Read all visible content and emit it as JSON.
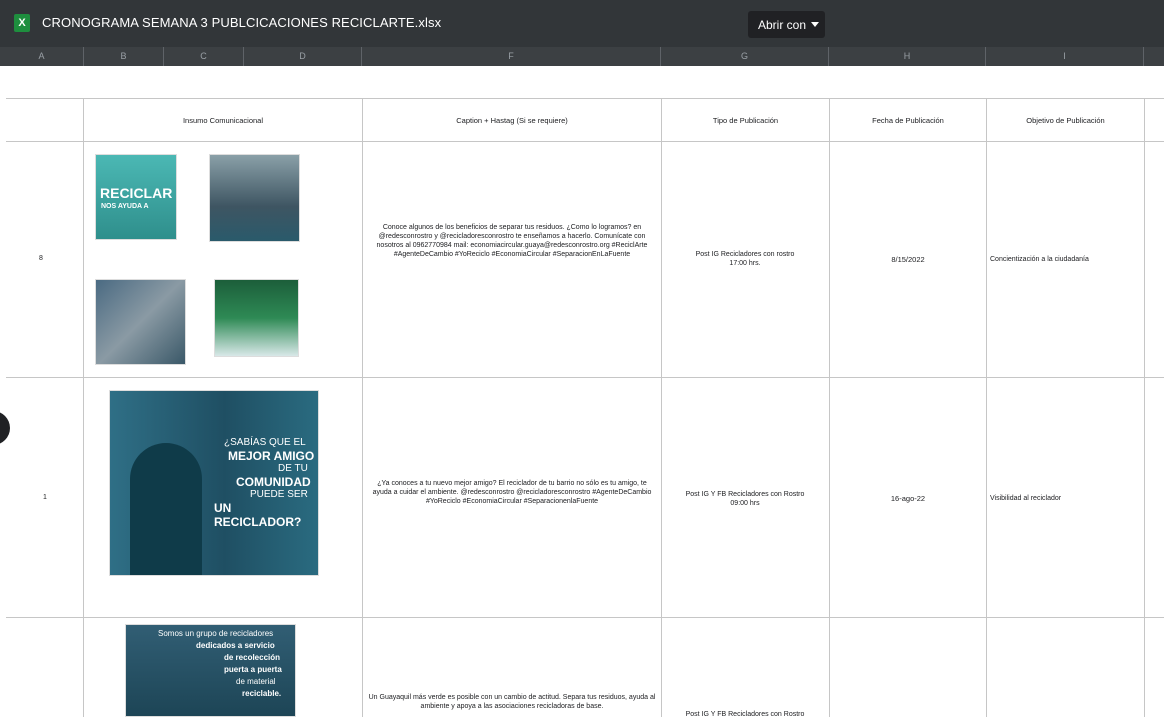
{
  "app": {
    "file_icon": "excel-file-icon",
    "filename": "CRONOGRAMA SEMANA 3 PUBLCICACIONES RECICLARTE.xlsx",
    "open_with_label": "Abrir con",
    "open_with_icon": "caret-down-icon"
  },
  "column_letters": [
    "A",
    "B",
    "C",
    "D",
    "F",
    "G",
    "H",
    "I"
  ],
  "headers": {
    "insumo": "Insumo Comunicacional",
    "caption": "Caption + Hastag (Si se requiere)",
    "tipo": "Tipo de Publicación",
    "fecha": "Fecha de Publicación",
    "objetivo": "Objetivo de Publicación"
  },
  "rows": [
    {
      "num": "8",
      "caption": "Conoce algunos de los beneficios de separar tus residuos. ¿Como lo logramos? en @redesconrostro y @recicladoresconrostro te enseñamos a hacerlo. Comunícate con nosotros al 0962770984 mail: economiacircular.guaya@redesconrostro.org #ReciclArte #AgenteDeCambio #YoReciclo #EconomiaCircular #SeparacionEnLaFuente",
      "tipo_line1": "Post IG Recicladores con rostro",
      "tipo_line2": "17:00 hrs.",
      "fecha": "8/15/2022",
      "objetivo": "Concientización a la ciudadanía"
    },
    {
      "num": "1",
      "caption": "¿Ya conoces a tu nuevo mejor amigo? El reciclador de tu barrio no sólo es tu amigo, te ayuda a cuidar el ambiente. @redesconrostro @recicladoresconrostro #AgenteDeCambio #YoReciclo #EconomiaCircular #SeparacionenlaFuente",
      "tipo_line1": "Post IG Y FB Recicladores con Rostro",
      "tipo_line2": "09:00 hrs",
      "fecha": "16-ago-22",
      "objetivo": "Visibilidad al reciclador"
    },
    {
      "num": "",
      "caption": "Un Guayaquil más verde es posible con un cambio de actitud. Separa tus residuos, ayuda al ambiente y apoya a las asociaciones recicladoras de base.",
      "tipo_line1": "Post IG Y FB Recicladores con Rostro",
      "tipo_line2": "",
      "fecha": "",
      "objetivo": ""
    }
  ],
  "images": {
    "img1_title": "RECICLAR",
    "img1_sub": "NOS AYUDA A",
    "img2_line1": "¿SABÍAS QUE EL",
    "img2_line2": "MEJOR AMIGO",
    "img2_line3": "DE TU",
    "img2_line4": "COMUNIDAD",
    "img2_line5": "PUEDE SER",
    "img2_line6": "UN RECICLADOR?",
    "img3_line1": "Somos un grupo de recicladores",
    "img3_line2": "dedicados a servicio",
    "img3_line3": "de recolección",
    "img3_line4": "puerta a puerta",
    "img3_line5": "de material",
    "img3_line6": "reciclable."
  }
}
